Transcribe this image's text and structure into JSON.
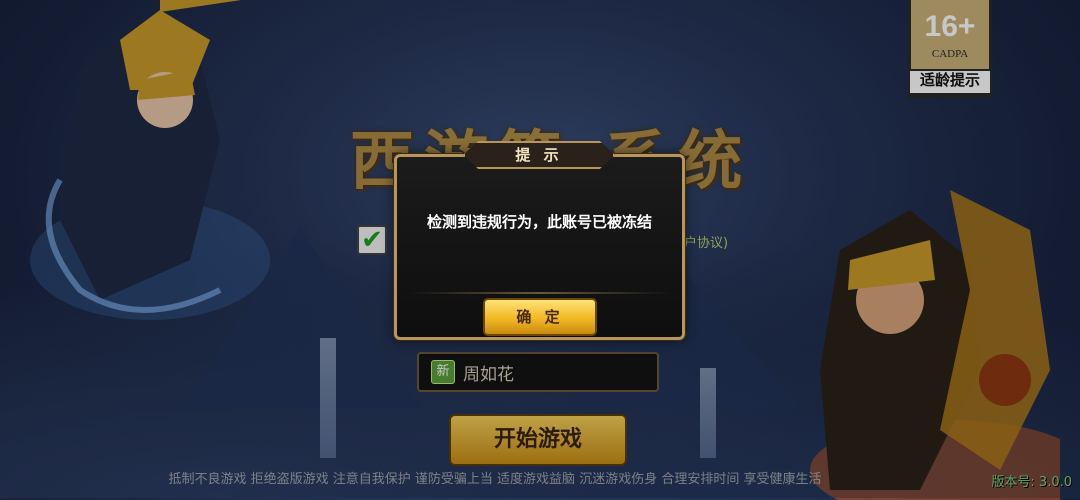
{
  "age_rating": {
    "age": "16+",
    "org": "CADPA",
    "tip": "适龄提示"
  },
  "logo": {
    "text": "西游篇·系统"
  },
  "agreement": {
    "fragment": "户协议)"
  },
  "dialog": {
    "title": "提 示",
    "message": "检测到违规行为，此账号已被冻结",
    "confirm_label": "确 定"
  },
  "server": {
    "new_tag": "新",
    "name": "周如花"
  },
  "start_button": {
    "label": "开始游戏"
  },
  "footer": {
    "disclaimer": "抵制不良游戏 拒绝盗版游戏 注意自我保护 谨防受骗上当 适度游戏益脑 沉迷游戏伤身 合理安排时间 享受健康生活",
    "version": "版本号: 3.0.0"
  },
  "colors": {
    "gold": "#b8955a",
    "button": "#f1b822",
    "version_green": "#7fd37a"
  }
}
